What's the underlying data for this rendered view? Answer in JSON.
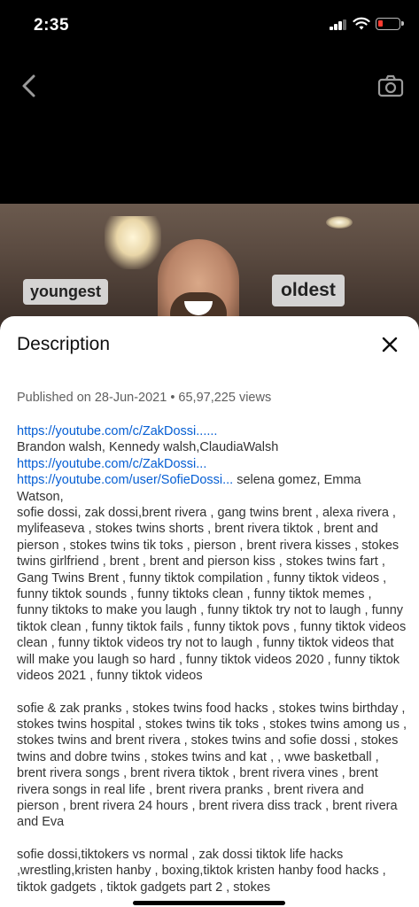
{
  "status_bar": {
    "time": "2:35",
    "battery_color": "#ff3b30"
  },
  "video": {
    "caption_left": "youngest",
    "caption_right": "oldest"
  },
  "description_panel": {
    "title": "Description",
    "published": "Published on 28-Jun-2021 • 65,97,225 views",
    "link_1": "https://youtube.com/c/ZakDossi......",
    "names_line": "Brandon walsh, Kennedy walsh,ClaudiaWalsh",
    "link_2": "https://youtube.com/c/ZakDossi...",
    "link_3": "https://youtube.com/user/SofieDossi...",
    "after_link_3": " selena gomez, Emma Watson,",
    "para_1": "sofie dossi, zak dossi,brent rivera , gang twins brent , alexa rivera , mylifeaseva , stokes twins shorts , brent rivera tiktok , brent and pierson , stokes twins tik toks , pierson , brent rivera kisses , stokes twins girlfriend , brent , brent and pierson kiss , stokes twins fart , Gang Twins Brent , funny tiktok compilation , funny tiktok videos , funny tiktok sounds , funny tiktoks clean , funny tiktok memes , funny tiktoks to make you laugh , funny tiktok try not to laugh , funny tiktok clean , funny tiktok fails , funny tiktok povs , funny tiktok videos clean , funny tiktok videos try not to laugh , funny tiktok videos that will make you laugh so hard , funny tiktok videos 2020 , funny tiktok videos 2021 , funny tiktok videos",
    "para_2": "sofie & zak pranks , stokes twins food hacks , stokes twins birthday , stokes twins hospital , stokes twins tik toks , stokes twins among us , stokes twins and brent rivera , stokes twins and sofie dossi , stokes twins and dobre twins , stokes twins and kat , , wwe basketball , brent rivera songs , brent rivera tiktok , brent rivera vines , brent rivera songs in real life , brent rivera pranks , brent rivera and pierson , brent rivera 24 hours , brent rivera diss track , brent rivera and Eva",
    "para_3": "sofie dossi,tiktokers vs normal , zak dossi tiktok life hacks ,wrestling,kristen hanby , boxing,tiktok kristen hanby food hacks , tiktok gadgets , tiktok gadgets part 2 , stokes"
  }
}
